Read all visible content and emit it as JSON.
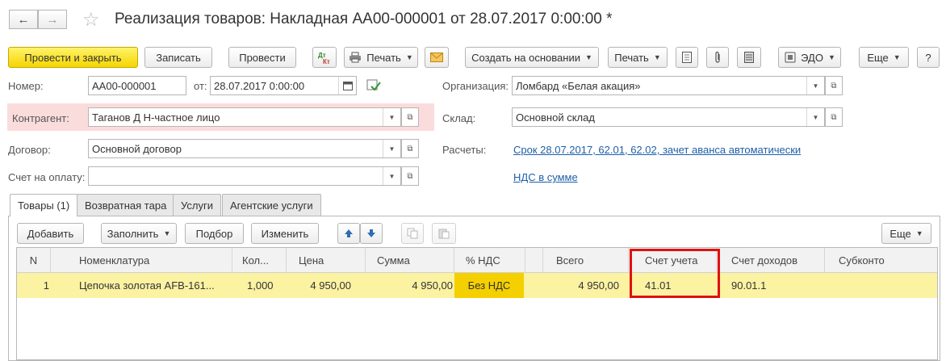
{
  "window": {
    "title": "Реализация товаров: Накладная АА00-000001 от 28.07.2017 0:00:00 *"
  },
  "toolbar": {
    "post_close": "Провести и закрыть",
    "save": "Записать",
    "post": "Провести",
    "print": "Печать",
    "create_based": "Создать на основании",
    "print2": "Печать",
    "edo": "ЭДО",
    "more": "Еще",
    "help": "?"
  },
  "form": {
    "number_label": "Номер:",
    "number_value": "АА00-000001",
    "date_label": "от:",
    "date_value": "28.07.2017  0:00:00",
    "org_label": "Организация:",
    "org_value": "Ломбард «Белая акация»",
    "counterparty_label": "Контрагент:",
    "counterparty_value": "Таганов Д Н-частное лицо",
    "warehouse_label": "Склад:",
    "warehouse_value": "Основной склад",
    "contract_label": "Договор:",
    "contract_value": "Основной договор",
    "settlements_label": "Расчеты:",
    "settlements_link": "Срок 28.07.2017, 62.01, 62.02, зачет аванса автоматически",
    "invoice_label": "Счет на оплату:",
    "invoice_value": "",
    "vat_link": "НДС в сумме"
  },
  "tabs": [
    {
      "label": "Товары (1)",
      "active": true
    },
    {
      "label": "Возвратная тара",
      "active": false
    },
    {
      "label": "Услуги",
      "active": false
    },
    {
      "label": "Агентские услуги",
      "active": false
    }
  ],
  "table_toolbar": {
    "add": "Добавить",
    "fill": "Заполнить",
    "select": "Подбор",
    "change": "Изменить",
    "more": "Еще"
  },
  "table": {
    "columns": [
      "N",
      "Номенклатура",
      "Кол...",
      "Цена",
      "Сумма",
      "% НДС",
      "Всего",
      "Счет учета",
      "Счет доходов",
      "Субконто"
    ],
    "rows": [
      {
        "n": "1",
        "item": "Цепочка золотая AFB-161...",
        "qty": "1,000",
        "price": "4 950,00",
        "sum": "4 950,00",
        "vat": "Без НДС",
        "total": "4 950,00",
        "account": "41.01",
        "income_account": "90.01.1",
        "subconto": ""
      }
    ]
  },
  "colors": {
    "primary_button": "#f5d500",
    "selected_row": "#fbf2a2",
    "vat_cell": "#f5d000",
    "counterparty_bg": "#fbdcdc",
    "highlight_border": "#e01010",
    "link": "#1f5fa8"
  }
}
